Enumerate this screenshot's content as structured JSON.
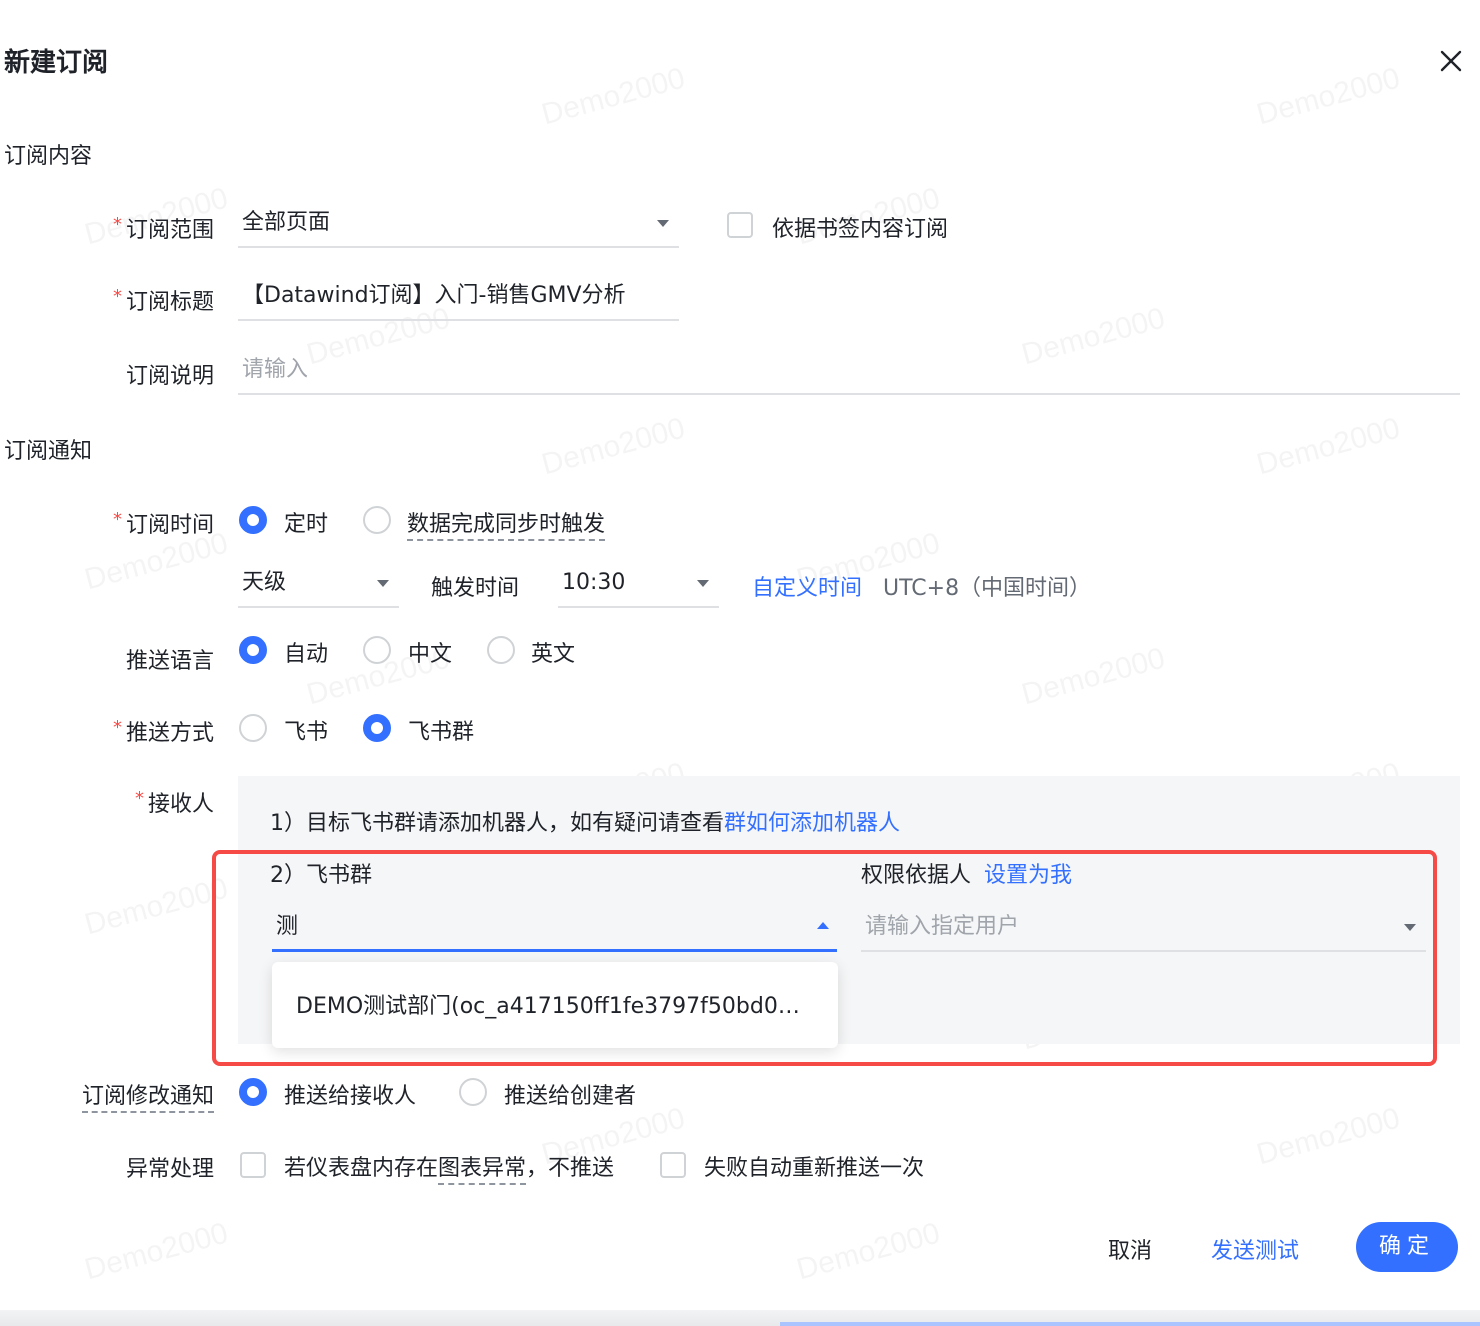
{
  "dialog": {
    "title": "新建订阅"
  },
  "watermark": "Demo2000",
  "content_section": {
    "title": "订阅内容",
    "scope": {
      "label": "订阅范围",
      "value": "全部页面"
    },
    "bookmark_checkbox": {
      "label": "依据书签内容订阅",
      "checked": false
    },
    "subject": {
      "label": "订阅标题",
      "value": "【Datawind订阅】入门-销售GMV分析"
    },
    "description": {
      "label": "订阅说明",
      "placeholder": "请输入"
    }
  },
  "notify_section": {
    "title": "订阅通知",
    "time": {
      "label": "订阅时间",
      "options": [
        "定时",
        "数据完成同步时触发"
      ],
      "selected": "定时",
      "frequency": "天级",
      "trigger_label": "触发时间",
      "trigger_time": "10:30",
      "custom_link": "自定义时间",
      "timezone": "UTC+8（中国时间）"
    },
    "language": {
      "label": "推送语言",
      "options": [
        "自动",
        "中文",
        "英文"
      ],
      "selected": "自动"
    },
    "method": {
      "label": "推送方式",
      "options": [
        "飞书",
        "飞书群"
      ],
      "selected": "飞书群"
    },
    "receiver": {
      "label": "接收人",
      "tip_prefix": "1）目标飞书群请添加机器人，如有疑问请查看",
      "tip_link": "群如何添加机器人",
      "group_label": "2）飞书群",
      "group_input": "测",
      "group_option": "DEMO测试部门(oc_a417150ff1fe3797f50bd0…",
      "permission_label": "权限依据人",
      "permission_link": "设置为我",
      "permission_placeholder": "请输入指定用户"
    },
    "modify_notice": {
      "label": "订阅修改通知",
      "options": [
        "推送给接收人",
        "推送给创建者"
      ],
      "selected": "推送给接收人"
    },
    "exception": {
      "label": "异常处理",
      "option1_prefix": "若仪表盘内存在",
      "option1_term": "图表异常",
      "option1_suffix": "，不推送",
      "option2": "失败自动重新推送一次"
    }
  },
  "footer": {
    "cancel": "取消",
    "send_test": "发送测试",
    "confirm": "确定"
  },
  "colors": {
    "primary": "#3370ff",
    "required": "#f54a45",
    "highlight_frame": "#f54a45"
  }
}
